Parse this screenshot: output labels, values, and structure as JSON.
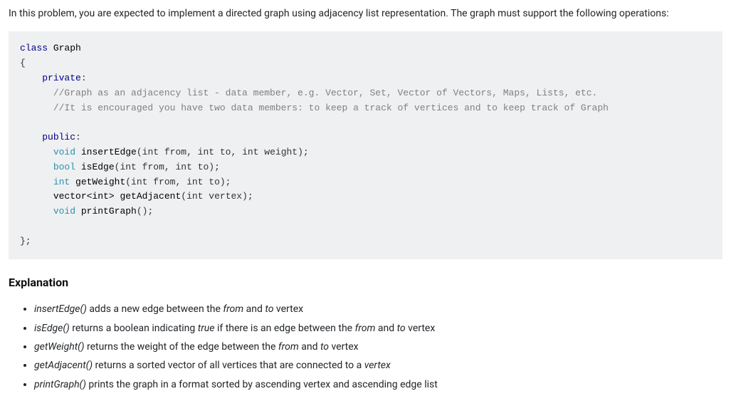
{
  "intro": "In this problem, you are expected to implement a directed graph using adjacency list representation. The graph must support the following operations:",
  "code": {
    "class_kw": "class",
    "class_name": "Graph",
    "open_brace": "{",
    "private_kw": "private",
    "comment1": "//Graph as an adjacency list - data member, e.g. Vector, Set, Vector of Vectors, Maps, Lists, etc.",
    "comment2": "//It is encouraged you have two data members: to keep a track of vertices and to keep track of Graph",
    "public_kw": "public",
    "void_kw": "void",
    "bool_kw": "bool",
    "int_kw": "int",
    "vec_type": "vector<int>",
    "insertEdge": "insertEdge",
    "insertEdge_params": "(int from, int to, int weight);",
    "isEdge": "isEdge",
    "isEdge_params": "(int from, int to);",
    "getWeight": "getWeight",
    "getWeight_params": "(int from, int to);",
    "getAdjacent": "getAdjacent",
    "getAdjacent_params": "(int vertex);",
    "printGraph": "printGraph",
    "printGraph_params": "();",
    "close_brace": "};"
  },
  "explanation_heading": "Explanation",
  "bullets": [
    {
      "fn": "insertEdge()",
      "mid1": " adds a new edge between the ",
      "i1": "from",
      "mid2": " and ",
      "i2": "to",
      "tail": " vertex"
    },
    {
      "fn": "isEdge()",
      "mid1": " returns a boolean indicating ",
      "i1": "true",
      "mid2": " if there is an edge between the ",
      "i2": "from",
      "mid3": " and ",
      "i3": "to",
      "tail": " vertex"
    },
    {
      "fn": "getWeight()",
      "mid1": " returns the weight of the edge between the ",
      "i1": "from",
      "mid2": " and ",
      "i2": "to",
      "tail": " vertex"
    },
    {
      "fn": "getAdjacent()",
      "mid1": " returns a sorted vector of all vertices that are connected to a ",
      "i1": "vertex",
      "tail": ""
    },
    {
      "fn": "printGraph()",
      "mid1": " prints the graph in a format sorted by ascending vertex and ascending edge list",
      "tail": ""
    }
  ]
}
